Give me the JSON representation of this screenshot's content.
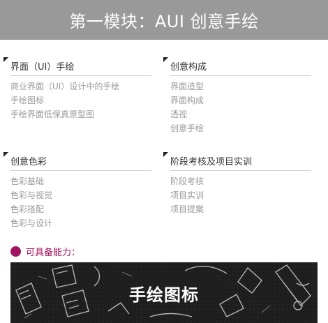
{
  "header": {
    "title": "第一模块：AUI 创意手绘"
  },
  "modules": [
    {
      "title": "界面（UI）手绘",
      "items": [
        "商业界面（UI）设计中的手绘",
        "手绘图标",
        "手绘界面低保真原型图"
      ]
    },
    {
      "title": "创意构成",
      "items": [
        "界面造型",
        "界面构成",
        "透视",
        "创意手绘"
      ]
    },
    {
      "title": "创意色彩",
      "items": [
        "色彩基础",
        "色彩与视觉",
        "色彩搭配",
        "色彩与设计"
      ]
    },
    {
      "title": "阶段考核及项目实训",
      "items": [
        "阶段考核",
        "项目实训",
        "项目提案"
      ]
    }
  ],
  "ability": {
    "label": "可具备能力："
  },
  "banner": {
    "title": "手绘图标"
  },
  "colors": {
    "header_bg": "#999999",
    "accent": "#a2125e",
    "banner_bg": "#1e1e1e"
  }
}
